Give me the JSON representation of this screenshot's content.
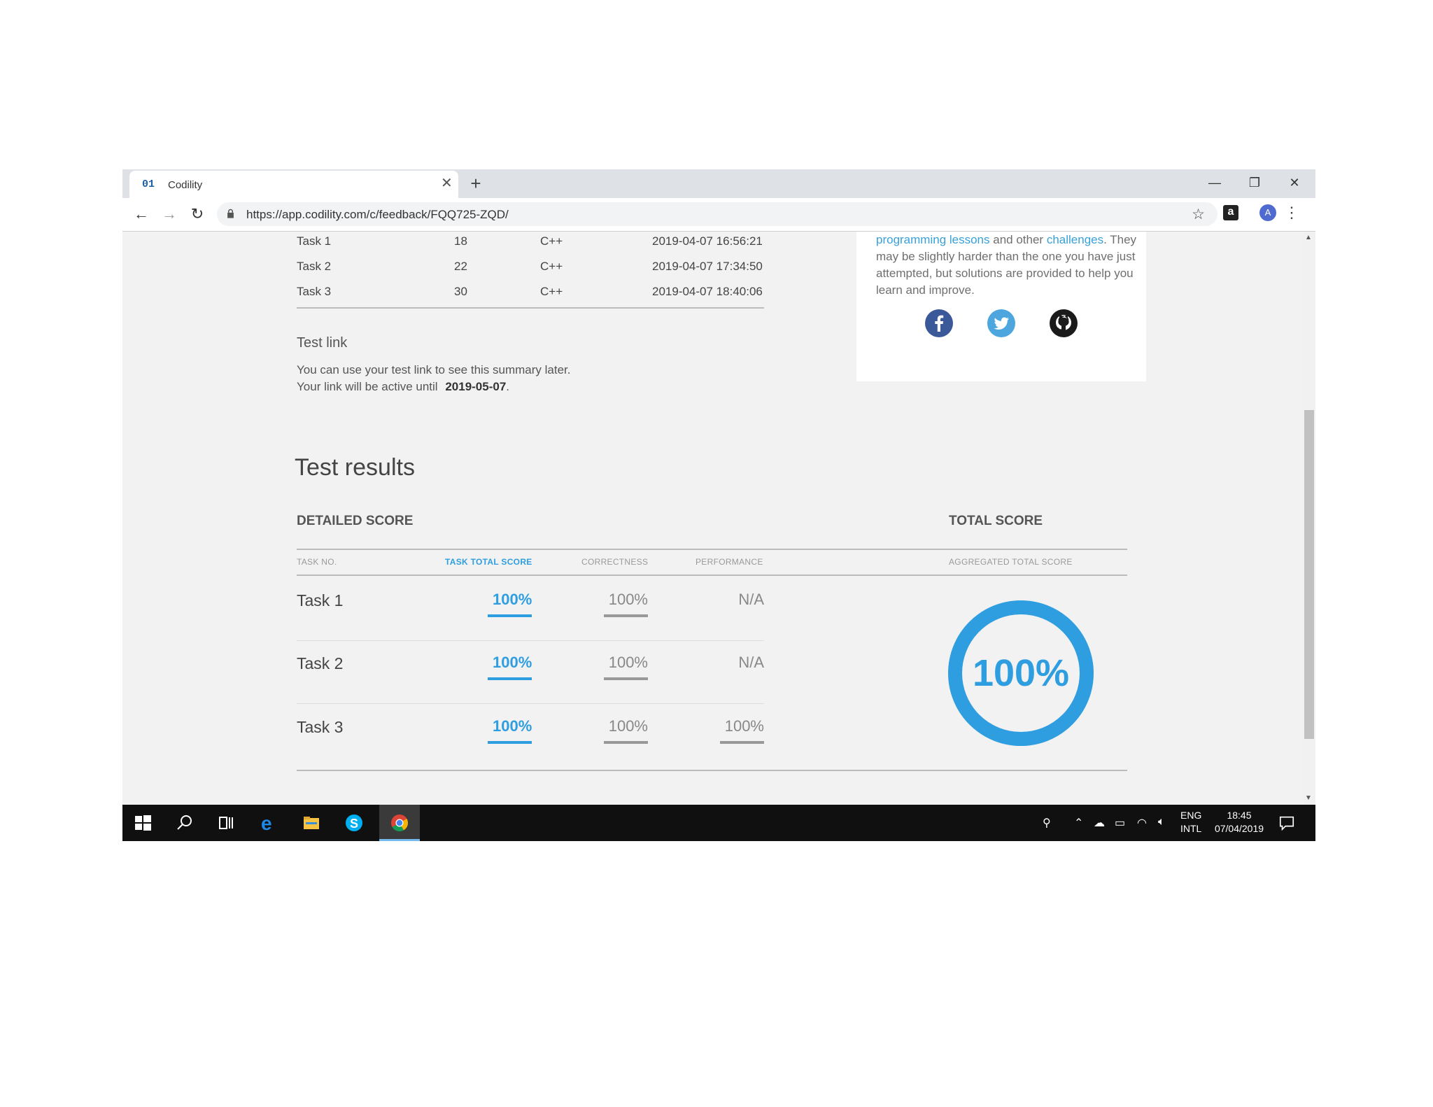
{
  "browser": {
    "tab_title": "Codility",
    "tab_favicon": "01",
    "url": "https://app.codility.com/c/feedback/FQQ725-ZQD/",
    "avatar_letter": "A"
  },
  "submissions": [
    {
      "task": "Task 1",
      "time": "18",
      "lang": "C++",
      "date": "2019-04-07 16:56:21"
    },
    {
      "task": "Task 2",
      "time": "22",
      "lang": "C++",
      "date": "2019-04-07 17:34:50"
    },
    {
      "task": "Task 3",
      "time": "30",
      "lang": "C++",
      "date": "2019-04-07 18:40:06"
    }
  ],
  "test_link": {
    "heading": "Test link",
    "line1": "You can use your test link to see this summary later.",
    "line2_prefix": "Your link will be active until",
    "active_until": "2019-05-07",
    "line2_suffix": "."
  },
  "side_card": {
    "link1": "programming lessons",
    "mid": "and other",
    "link2": "challenges",
    "trailing": ".",
    "text": "They may be slightly harder than the one you have just attempted, but solutions are provided to help you learn and improve."
  },
  "results": {
    "title": "Test results",
    "detailed_heading": "DETAILED SCORE",
    "total_heading": "TOTAL SCORE",
    "columns": {
      "task_no": "TASK NO.",
      "task_total": "TASK TOTAL SCORE",
      "correctness": "CORRECTNESS",
      "performance": "PERFORMANCE",
      "aggregated": "AGGREGATED TOTAL SCORE"
    },
    "rows": [
      {
        "task": "Task 1",
        "total": "100%",
        "correctness": "100%",
        "performance": "N/A"
      },
      {
        "task": "Task 2",
        "total": "100%",
        "correctness": "100%",
        "performance": "N/A"
      },
      {
        "task": "Task 3",
        "total": "100%",
        "correctness": "100%",
        "performance": "100%"
      }
    ],
    "total_score": "100%",
    "total_score_fraction": 1.0,
    "accent_color": "#2e9ee0"
  },
  "taskbar": {
    "lang_line1": "ENG",
    "lang_line2": "INTL",
    "time": "18:45",
    "date": "07/04/2019"
  }
}
